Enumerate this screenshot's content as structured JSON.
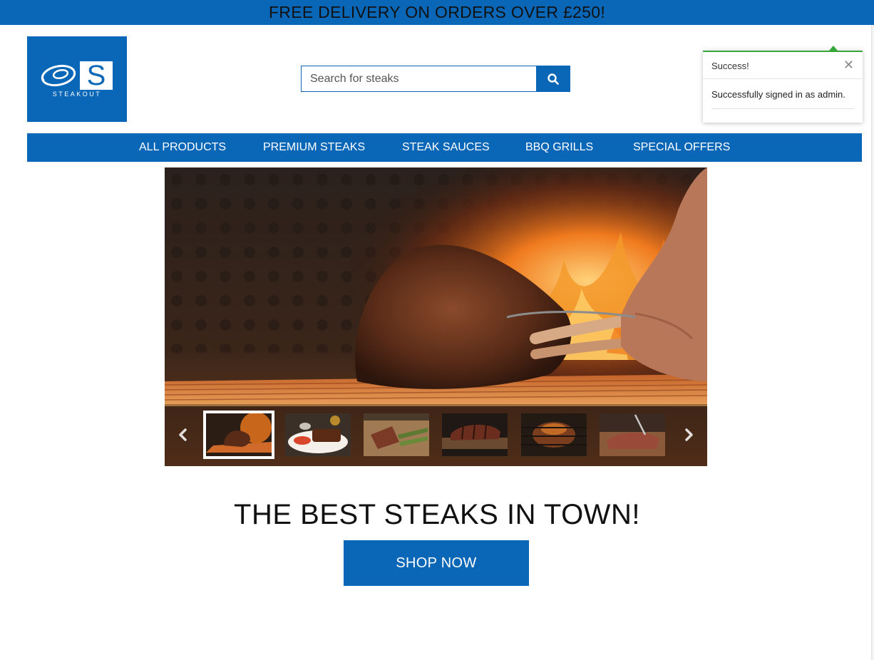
{
  "promo": {
    "text": "FREE DELIVERY ON ORDERS OVER £250!"
  },
  "logo": {
    "letter": "S",
    "brand": "STEAKOUT",
    "icon": "steak-icon"
  },
  "search": {
    "placeholder": "Search for steaks",
    "value": "",
    "button_icon": "search-icon"
  },
  "nav": {
    "items": [
      {
        "label": "ALL PRODUCTS"
      },
      {
        "label": "PREMIUM STEAKS"
      },
      {
        "label": "STEAK SAUCES"
      },
      {
        "label": "BBQ GRILLS"
      },
      {
        "label": "SPECIAL OFFERS"
      }
    ]
  },
  "toast": {
    "title": "Success!",
    "message": "Successfully signed in as admin.",
    "close_icon": "close-icon",
    "accent": "#35a83a"
  },
  "carousel": {
    "prev_icon": "chevron-left-icon",
    "next_icon": "chevron-right-icon",
    "active_index": 0,
    "thumbnails": [
      {
        "name": "tomahawk-on-fire"
      },
      {
        "name": "ribs-platter"
      },
      {
        "name": "sliced-steak-asparagus"
      },
      {
        "name": "sliced-steak-board"
      },
      {
        "name": "steak-on-grill"
      },
      {
        "name": "steak-with-fork"
      }
    ]
  },
  "hero": {
    "headline": "THE BEST STEAKS IN TOWN!",
    "cta": "SHOP NOW"
  },
  "colors": {
    "brand": "#0a67b8",
    "text": "#111111",
    "success": "#35a83a"
  }
}
